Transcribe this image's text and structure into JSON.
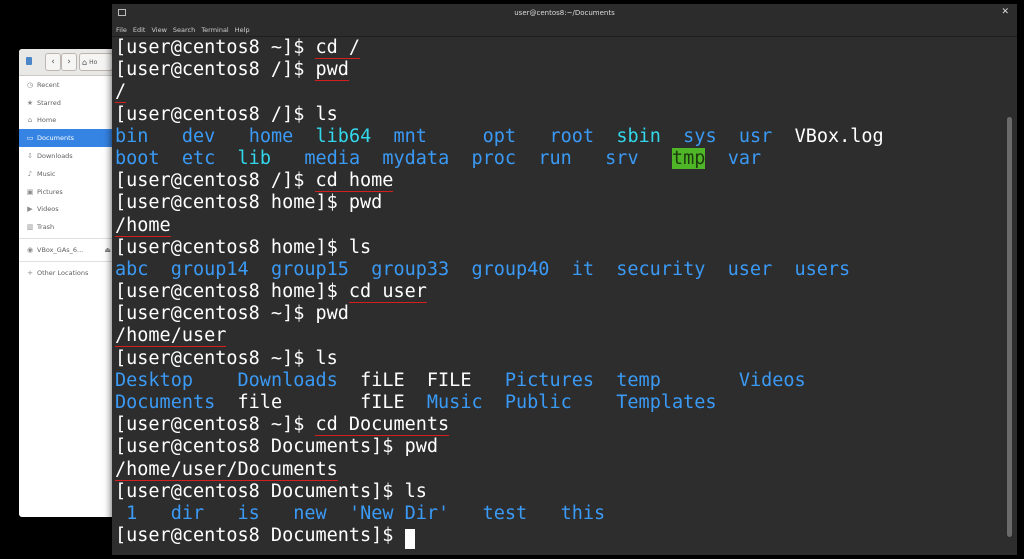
{
  "file_manager": {
    "toolbar_home": "Ho",
    "items": [
      {
        "icon": "clock-icon",
        "glyph": "◷",
        "label": "Recent"
      },
      {
        "icon": "star-icon",
        "glyph": "★",
        "label": "Starred"
      },
      {
        "icon": "home-icon",
        "glyph": "⌂",
        "label": "Home"
      },
      {
        "icon": "folder-icon",
        "glyph": "▭",
        "label": "Documents",
        "active": true
      },
      {
        "icon": "download-icon",
        "glyph": "⇩",
        "label": "Downloads"
      },
      {
        "icon": "music-icon",
        "glyph": "♪",
        "label": "Music"
      },
      {
        "icon": "picture-icon",
        "glyph": "▣",
        "label": "Pictures"
      },
      {
        "icon": "video-icon",
        "glyph": "▶",
        "label": "Videos"
      },
      {
        "icon": "trash-icon",
        "glyph": "▥",
        "label": "Trash"
      }
    ],
    "mount": {
      "icon": "disc-icon",
      "glyph": "◉",
      "label": "VBox_GAs_6..."
    },
    "other": {
      "icon": "plus-icon",
      "glyph": "+",
      "label": "Other Locations"
    }
  },
  "terminal": {
    "title": "user@centos8:~/Documents",
    "menu": [
      "File",
      "Edit",
      "View",
      "Search",
      "Terminal",
      "Help"
    ],
    "lines": [
      [
        {
          "t": "[user@centos8 ~]$ "
        },
        {
          "t": "cd /",
          "ul": true
        }
      ],
      [
        {
          "t": "[user@centos8 /]$ "
        },
        {
          "t": "pwd",
          "ul": true
        }
      ],
      [
        {
          "t": "/",
          "ul": true
        }
      ],
      [
        {
          "t": "[user@centos8 /]$ ls"
        }
      ],
      [
        {
          "t": "bin",
          "c": "dir"
        },
        {
          "t": "   "
        },
        {
          "t": "dev",
          "c": "dir"
        },
        {
          "t": "   "
        },
        {
          "t": "home",
          "c": "dir"
        },
        {
          "t": "  "
        },
        {
          "t": "lib64",
          "c": "link"
        },
        {
          "t": "  "
        },
        {
          "t": "mnt",
          "c": "dir"
        },
        {
          "t": "     "
        },
        {
          "t": "opt",
          "c": "dir"
        },
        {
          "t": "   "
        },
        {
          "t": "root",
          "c": "dir"
        },
        {
          "t": "  "
        },
        {
          "t": "sbin",
          "c": "link"
        },
        {
          "t": "  "
        },
        {
          "t": "sys",
          "c": "dir"
        },
        {
          "t": "  "
        },
        {
          "t": "usr",
          "c": "dir"
        },
        {
          "t": "  "
        },
        {
          "t": "VBox.log",
          "c": "white"
        }
      ],
      [
        {
          "t": "boot",
          "c": "dir"
        },
        {
          "t": "  "
        },
        {
          "t": "etc",
          "c": "dir"
        },
        {
          "t": "  "
        },
        {
          "t": "lib",
          "c": "link"
        },
        {
          "t": "   "
        },
        {
          "t": "media",
          "c": "dir"
        },
        {
          "t": "  "
        },
        {
          "t": "mydata",
          "c": "dir"
        },
        {
          "t": "  "
        },
        {
          "t": "proc",
          "c": "dir"
        },
        {
          "t": "  "
        },
        {
          "t": "run",
          "c": "dir"
        },
        {
          "t": "   "
        },
        {
          "t": "srv",
          "c": "dir"
        },
        {
          "t": "   "
        },
        {
          "t": "tmp",
          "c": "tmp"
        },
        {
          "t": "  "
        },
        {
          "t": "var",
          "c": "dir"
        }
      ],
      [
        {
          "t": "[user@centos8 /]$ "
        },
        {
          "t": "cd home",
          "ul": true
        }
      ],
      [
        {
          "t": "[user@centos8 home]$ pwd"
        }
      ],
      [
        {
          "t": "/home",
          "ul": true
        }
      ],
      [
        {
          "t": "[user@centos8 home]$ ls"
        }
      ],
      [
        {
          "t": "abc",
          "c": "dir"
        },
        {
          "t": "  "
        },
        {
          "t": "group14",
          "c": "dir"
        },
        {
          "t": "  "
        },
        {
          "t": "group15",
          "c": "dir"
        },
        {
          "t": "  "
        },
        {
          "t": "group33",
          "c": "dir"
        },
        {
          "t": "  "
        },
        {
          "t": "group40",
          "c": "dir"
        },
        {
          "t": "  "
        },
        {
          "t": "it",
          "c": "dir"
        },
        {
          "t": "  "
        },
        {
          "t": "security",
          "c": "dir"
        },
        {
          "t": "  "
        },
        {
          "t": "user",
          "c": "dir"
        },
        {
          "t": "  "
        },
        {
          "t": "users",
          "c": "dir"
        }
      ],
      [
        {
          "t": "[user@centos8 home]$ "
        },
        {
          "t": "cd user",
          "ul": true
        }
      ],
      [
        {
          "t": "[user@centos8 ~]$ pwd"
        }
      ],
      [
        {
          "t": "/home/user",
          "ul": true
        }
      ],
      [
        {
          "t": "[user@centos8 ~]$ ls"
        }
      ],
      [
        {
          "t": "Desktop",
          "c": "dir"
        },
        {
          "t": "    "
        },
        {
          "t": "Downloads",
          "c": "dir"
        },
        {
          "t": "  "
        },
        {
          "t": "fiLE",
          "c": "white"
        },
        {
          "t": "  "
        },
        {
          "t": "FILE",
          "c": "white"
        },
        {
          "t": "   "
        },
        {
          "t": "Pictures",
          "c": "dir"
        },
        {
          "t": "  "
        },
        {
          "t": "temp",
          "c": "dir"
        },
        {
          "t": "       "
        },
        {
          "t": "Videos",
          "c": "dir"
        }
      ],
      [
        {
          "t": "Documents",
          "c": "dir"
        },
        {
          "t": "  "
        },
        {
          "t": "file",
          "c": "white"
        },
        {
          "t": "       "
        },
        {
          "t": "fILE",
          "c": "white"
        },
        {
          "t": "  "
        },
        {
          "t": "Music",
          "c": "dir"
        },
        {
          "t": "  "
        },
        {
          "t": "Public",
          "c": "dir"
        },
        {
          "t": "    "
        },
        {
          "t": "Templates",
          "c": "dir"
        }
      ],
      [
        {
          "t": "[user@centos8 ~]$ "
        },
        {
          "t": "cd Documents",
          "ul": true
        }
      ],
      [
        {
          "t": "[user@centos8 Documents]$ pwd"
        }
      ],
      [
        {
          "t": "/home/user/Documents",
          "ul": true
        }
      ],
      [
        {
          "t": "[user@centos8 Documents]$ ls"
        }
      ],
      [
        {
          "t": " 1",
          "c": "dir"
        },
        {
          "t": "   "
        },
        {
          "t": "dir",
          "c": "dir"
        },
        {
          "t": "   "
        },
        {
          "t": "is",
          "c": "dir"
        },
        {
          "t": "   "
        },
        {
          "t": "new",
          "c": "dir"
        },
        {
          "t": "  "
        },
        {
          "t": "'New Dir'",
          "c": "dir"
        },
        {
          "t": "   "
        },
        {
          "t": "test",
          "c": "dir"
        },
        {
          "t": "   "
        },
        {
          "t": "this",
          "c": "dir"
        }
      ],
      [
        {
          "t": "[user@centos8 Documents]$ "
        },
        {
          "cursor": true
        }
      ]
    ]
  }
}
